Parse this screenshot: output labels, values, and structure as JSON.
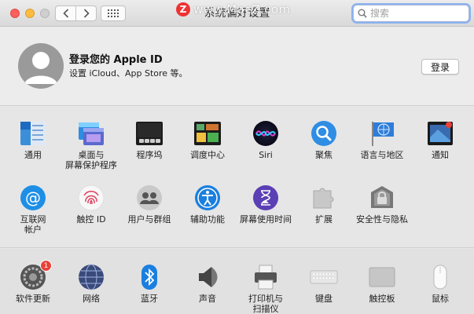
{
  "window": {
    "title": "系统偏好设置",
    "watermark": "www.MacZ.com",
    "watermark_logo": "Z"
  },
  "search": {
    "placeholder": "搜索"
  },
  "account": {
    "title": "登录您的 Apple ID",
    "subtitle": "设置 iCloud、App Store 等。",
    "login_label": "登录"
  },
  "panes_row1": [
    {
      "name": "general",
      "label": "通用",
      "icon": "general-icon"
    },
    {
      "name": "desktop-screensaver",
      "label": "桌面与\n屏幕保护程序",
      "icon": "desktop-icon"
    },
    {
      "name": "dock",
      "label": "程序坞",
      "icon": "dock-icon"
    },
    {
      "name": "mission-control",
      "label": "调度中心",
      "icon": "mission-control-icon"
    },
    {
      "name": "siri",
      "label": "Siri",
      "icon": "siri-icon"
    },
    {
      "name": "spotlight",
      "label": "聚焦",
      "icon": "spotlight-icon"
    },
    {
      "name": "language-region",
      "label": "语言与地区",
      "icon": "language-icon"
    },
    {
      "name": "notifications",
      "label": "通知",
      "icon": "notifications-icon"
    }
  ],
  "panes_row2": [
    {
      "name": "internet-accounts",
      "label": "互联网\n帐户",
      "icon": "internet-accounts-icon"
    },
    {
      "name": "touch-id",
      "label": "触控 ID",
      "icon": "fingerprint-icon"
    },
    {
      "name": "users-groups",
      "label": "用户与群组",
      "icon": "users-icon"
    },
    {
      "name": "accessibility",
      "label": "辅助功能",
      "icon": "accessibility-icon"
    },
    {
      "name": "screen-time",
      "label": "屏幕使用时间",
      "icon": "screen-time-icon"
    },
    {
      "name": "extensions",
      "label": "扩展",
      "icon": "extensions-icon"
    },
    {
      "name": "security-privacy",
      "label": "安全性与隐私",
      "icon": "security-icon"
    }
  ],
  "panes_row3": [
    {
      "name": "software-update",
      "label": "软件更新",
      "icon": "software-update-icon",
      "badge": "1"
    },
    {
      "name": "network",
      "label": "网络",
      "icon": "network-icon"
    },
    {
      "name": "bluetooth",
      "label": "蓝牙",
      "icon": "bluetooth-icon"
    },
    {
      "name": "sound",
      "label": "声音",
      "icon": "sound-icon"
    },
    {
      "name": "printers-scanners",
      "label": "打印机与\n扫描仪",
      "icon": "printer-icon"
    },
    {
      "name": "keyboard",
      "label": "键盘",
      "icon": "keyboard-icon"
    },
    {
      "name": "trackpad",
      "label": "触控板",
      "icon": "trackpad-icon"
    },
    {
      "name": "mouse",
      "label": "鼠标",
      "icon": "mouse-icon"
    }
  ]
}
